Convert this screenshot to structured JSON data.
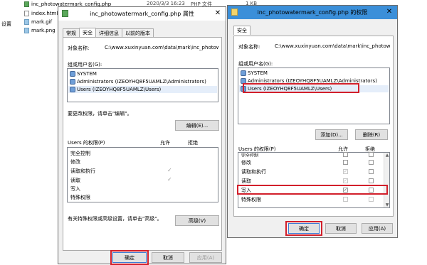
{
  "explorer": {
    "left_label": "设置",
    "files": [
      {
        "name": "inc_photowatermark_config.php",
        "date": "2020/3/3 16:23",
        "type": "PHP 文件",
        "size": "1 KB"
      },
      {
        "name": "index.html"
      },
      {
        "name": "mark.gif"
      },
      {
        "name": "mark.png"
      }
    ]
  },
  "props": {
    "title": "inc_photowatermark_config.php 属性",
    "tabs": [
      "常规",
      "安全",
      "详细信息",
      "以前的版本"
    ],
    "object_label": "对象名称:",
    "object_value": "C:\\www.xuxinyuan.com\\data\\mark\\inc_photowatermark_config.php",
    "groups_label": "组或用户名(G):",
    "users": [
      "SYSTEM",
      "Administrators (IZEOYHQ8F5UAMLZ\\Administrators)",
      "Users (IZEOYHQ8F5UAMLZ\\Users)"
    ],
    "change_hint": "要更改权限，请单击\"编辑\"。",
    "edit_button": "编辑(E)...",
    "perm_label": "Users 的权限(P)",
    "allow_header": "允许",
    "deny_header": "拒绝",
    "perms": [
      "完全控制",
      "修改",
      "读取和执行",
      "读取",
      "写入",
      "特殊权限"
    ],
    "special_hint": "有关特殊权限或高级设置，请单击\"高级\"。",
    "advanced_button": "高级(V)",
    "ok": "确定",
    "cancel": "取消",
    "apply": "应用(A)"
  },
  "perm_dialog": {
    "title": "inc_photowatermark_config.php 的权限",
    "tab": "安全",
    "object_label": "对象名称:",
    "object_value": "C:\\www.xuxinyuan.com\\data\\mark\\inc_photowatermark_config.php",
    "groups_label": "组或用户名(G):",
    "users": [
      "SYSTEM",
      "Administrators (IZEOYHQ8F5UAMLZ\\Administrators)",
      "Users (IZEOYHQ8F5UAMLZ\\Users)"
    ],
    "add_button": "添加(D)...",
    "remove_button": "删除(R)",
    "perm_label": "Users 的权限(P)",
    "allow_header": "允许",
    "deny_header": "拒绝",
    "perms": [
      "完全控制",
      "修改",
      "读取和执行",
      "读取",
      "写入",
      "特殊权限"
    ],
    "ok": "确定",
    "cancel": "取消",
    "apply": "应用(A)"
  },
  "colors": {
    "highlight": "#d21f2b",
    "accent_title": "#3b8fd9"
  }
}
